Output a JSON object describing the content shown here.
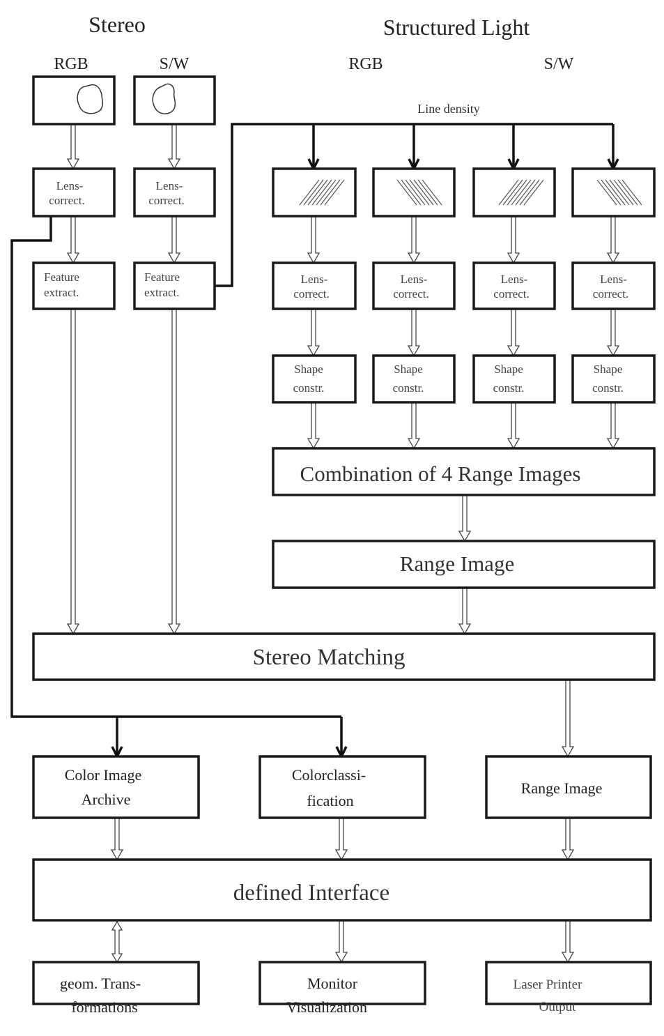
{
  "headers": {
    "stereo": "Stereo",
    "structured_light": "Structured Light",
    "stereo_rgb": "RGB",
    "stereo_sw": "S/W",
    "sl_rgb": "RGB",
    "sl_sw": "S/W"
  },
  "line_density": "Line density",
  "stereo_column": {
    "lens": [
      "Lens-",
      "correct."
    ],
    "feature": [
      "Feature",
      "extract."
    ]
  },
  "sl_column": {
    "lens": [
      "Lens-",
      "correct."
    ],
    "shape": [
      "Shape",
      "constr."
    ]
  },
  "combination": "Combination of 4 Range Images",
  "range_image_sl": "Range Image",
  "stereo_matching": "Stereo Matching",
  "outputs": {
    "color_archive": [
      "Color Image",
      "Archive"
    ],
    "color_class": [
      "Colorclassi-",
      "fication"
    ],
    "range_image": "Range Image"
  },
  "interface": "defined Interface",
  "consumers": {
    "geom": [
      "geom. Trans-",
      "formations"
    ],
    "monitor": [
      "Monitor",
      "Visualization"
    ],
    "printer": [
      "Laser Printer",
      "Output"
    ]
  }
}
